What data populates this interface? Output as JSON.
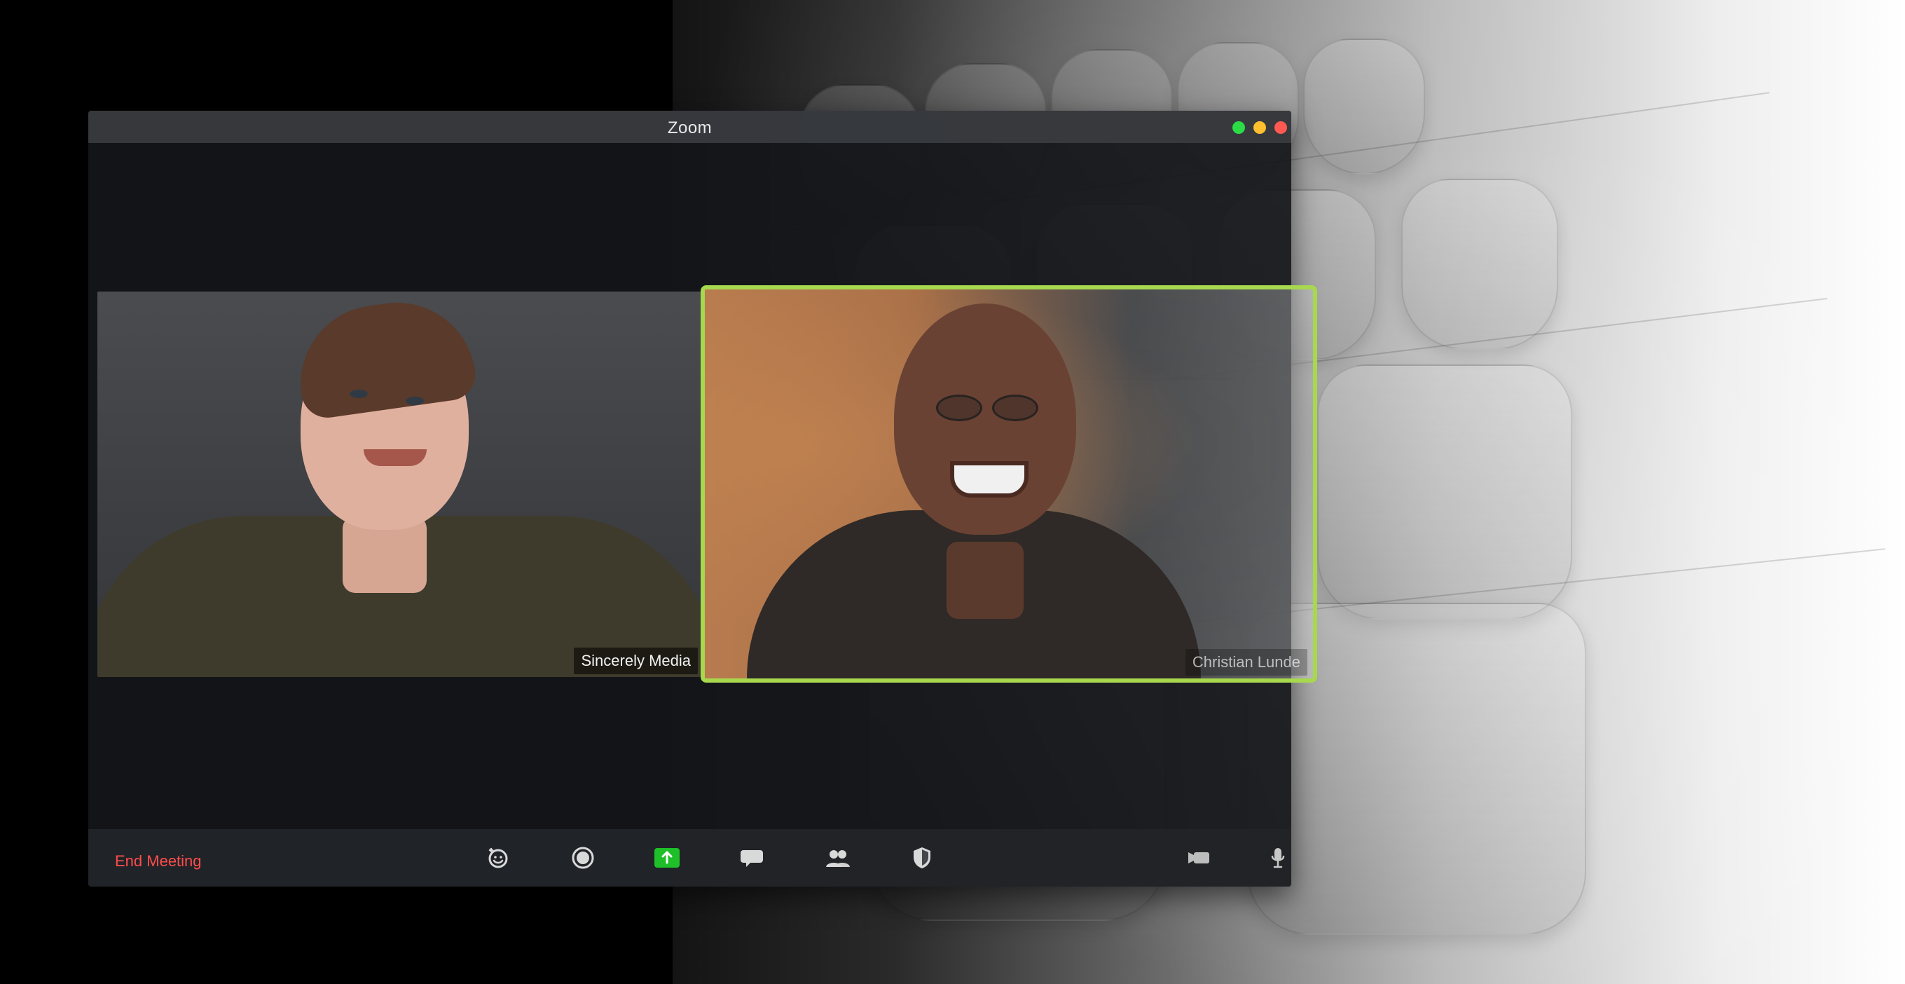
{
  "window": {
    "title": "Zoom"
  },
  "participants": [
    {
      "name": "Sincerely Media"
    },
    {
      "name": "Christian Lunde"
    }
  ],
  "toolbar": {
    "end_meeting_label": "End Meeting",
    "icons": [
      "reactions-icon",
      "record-icon",
      "share-screen-icon",
      "chat-icon",
      "participants-icon",
      "security-icon",
      "video-icon",
      "mic-icon"
    ]
  },
  "colors": {
    "active_speaker_border": "#a7d84e",
    "end_meeting": "#ff4d4d",
    "share_button": "#1fbf2a"
  }
}
